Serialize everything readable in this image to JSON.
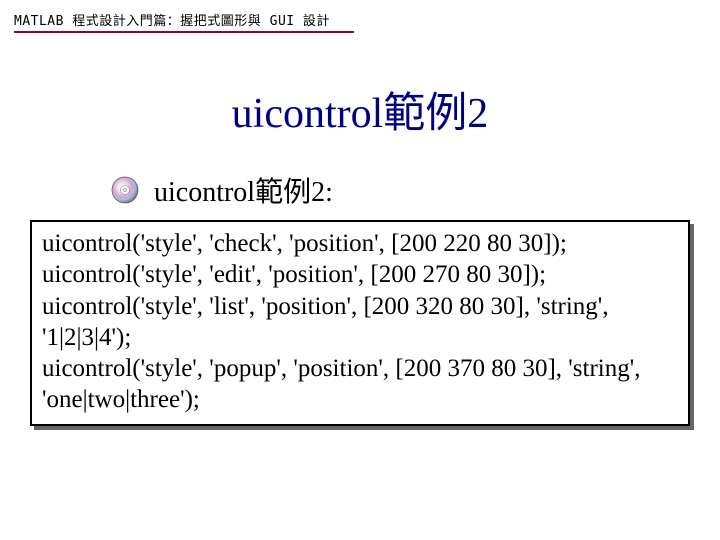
{
  "header": {
    "text": "MATLAB 程式設計入門篇：握把式圖形與 GUI 設計"
  },
  "title": "uicontrol範例2",
  "subtitle": "uicontrol範例2:",
  "code": {
    "line1": "uicontrol('style', 'check', 'position', [200 220 80 30]);",
    "line2": "uicontrol('style', 'edit', 'position', [200 270 80 30]);",
    "line3": "uicontrol('style', 'list', 'position', [200 320 80 30], 'string', '1|2|3|4');",
    "line4": "uicontrol('style', 'popup', 'position', [200 370 80 30], 'string', 'one|two|three');"
  }
}
